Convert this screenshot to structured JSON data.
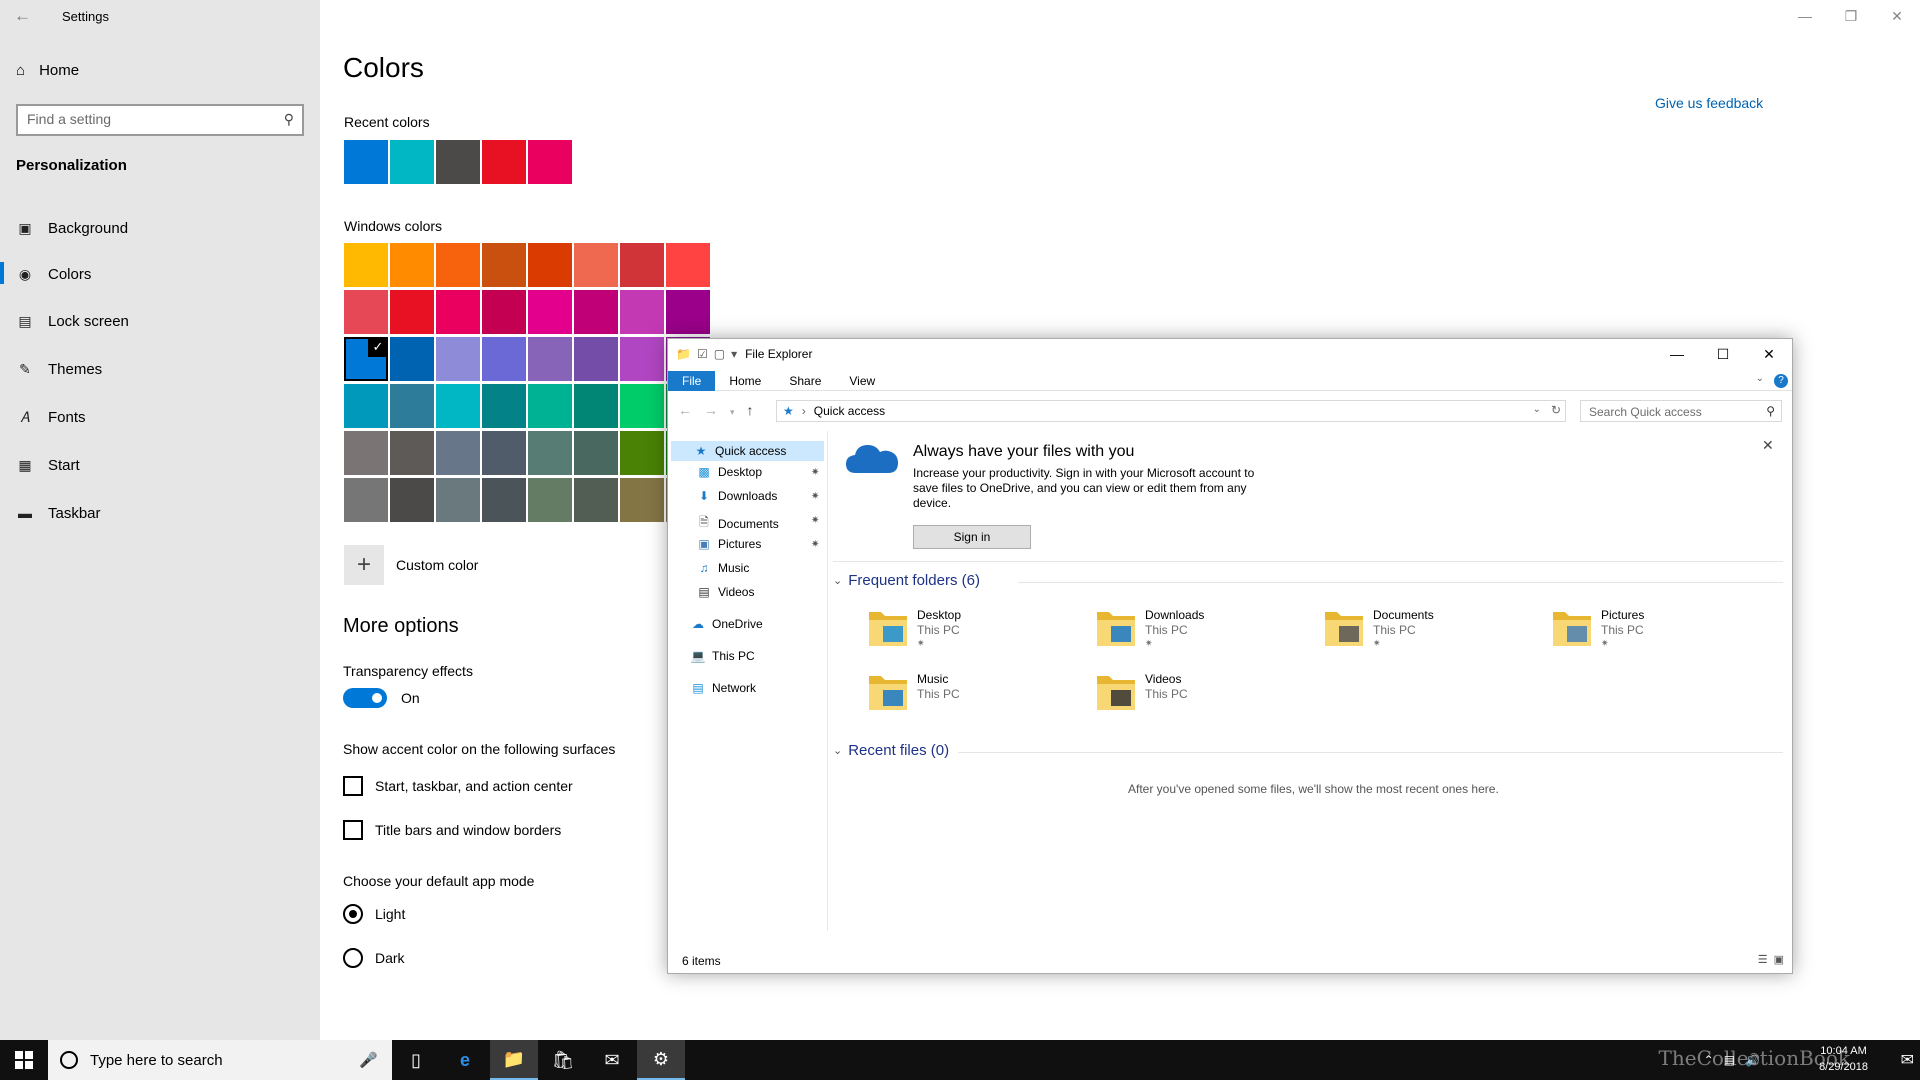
{
  "settings": {
    "title": "Settings",
    "home": "Home",
    "search_placeholder": "Find a setting",
    "section": "Personalization",
    "nav": [
      {
        "label": "Background",
        "icon": "picture-icon"
      },
      {
        "label": "Colors",
        "icon": "palette-icon"
      },
      {
        "label": "Lock screen",
        "icon": "monitor-icon"
      },
      {
        "label": "Themes",
        "icon": "brush-icon"
      },
      {
        "label": "Fonts",
        "icon": "font-icon"
      },
      {
        "label": "Start",
        "icon": "grid-icon"
      },
      {
        "label": "Taskbar",
        "icon": "taskbar-icon"
      }
    ],
    "active_nav": "Colors",
    "accent_color": "#0078d7"
  },
  "colors_page": {
    "title": "Colors",
    "feedback": "Give us feedback",
    "recent_label": "Recent colors",
    "recent_colors": [
      "#0078d7",
      "#00b7c3",
      "#4c4a48",
      "#e81123",
      "#ea005e"
    ],
    "windows_label": "Windows colors",
    "windows_colors": [
      [
        "#ffb900",
        "#ff8c00",
        "#f7630c",
        "#ca5010",
        "#da3b01",
        "#ef6950",
        "#d13438",
        "#ff4343"
      ],
      [
        "#e74856",
        "#e81123",
        "#ea005e",
        "#c30052",
        "#e3008c",
        "#bf0077",
        "#c239b3",
        "#9a0089"
      ],
      [
        "#0078d7",
        "#0063b1",
        "#8e8cd8",
        "#6b69d6",
        "#8764b8",
        "#744da9",
        "#b146c2",
        "#881798"
      ],
      [
        "#0099bc",
        "#2d7d9a",
        "#00b7c3",
        "#038387",
        "#00b294",
        "#018574",
        "#00cc6a",
        "#10893e"
      ],
      [
        "#7a7574",
        "#5d5a58",
        "#68768a",
        "#515c6b",
        "#567c73",
        "#486860",
        "#498205",
        "#107c10"
      ],
      [
        "#767676",
        "#4c4a48",
        "#69797e",
        "#4a5459",
        "#647c64",
        "#525e54",
        "#847545",
        "#7e735f"
      ]
    ],
    "selected_color": "#0078d7",
    "custom_color": "Custom color",
    "more_options": "More options",
    "transparency_label": "Transparency effects",
    "transparency_state": "On",
    "surfaces_label": "Show accent color on the following surfaces",
    "surface_options": [
      "Start, taskbar, and action center",
      "Title bars and window borders"
    ],
    "app_mode_label": "Choose your default app mode",
    "app_modes": [
      "Light",
      "Dark"
    ],
    "app_mode_selected": "Light"
  },
  "explorer": {
    "title": "File Explorer",
    "ribbon_tabs": [
      "File",
      "Home",
      "Share",
      "View"
    ],
    "address": "Quick access",
    "search_placeholder": "Search Quick access",
    "nav": {
      "quick_access": "Quick access",
      "pinned": [
        "Desktop",
        "Downloads",
        "Documents",
        "Pictures"
      ],
      "unpinned": [
        "Music",
        "Videos"
      ],
      "onedrive": "OneDrive",
      "this_pc": "This PC",
      "network": "Network"
    },
    "banner": {
      "title": "Always have your files with you",
      "text": "Increase your productivity. Sign in with your Microsoft account to save files to OneDrive, and you can view or edit them from any device.",
      "button": "Sign in"
    },
    "frequent_header": "Frequent folders (6)",
    "folders": [
      {
        "name": "Desktop",
        "location": "This PC",
        "pinned": true
      },
      {
        "name": "Downloads",
        "location": "This PC",
        "pinned": true
      },
      {
        "name": "Documents",
        "location": "This PC",
        "pinned": true
      },
      {
        "name": "Pictures",
        "location": "This PC",
        "pinned": true
      },
      {
        "name": "Music",
        "location": "This PC",
        "pinned": false
      },
      {
        "name": "Videos",
        "location": "This PC",
        "pinned": false
      }
    ],
    "recent_header": "Recent files (0)",
    "recent_empty": "After you've opened some files, we'll show the most recent ones here.",
    "status": "6 items"
  },
  "taskbar": {
    "search_placeholder": "Type here to search",
    "time": "10:04 AM",
    "date": "8/29/2018",
    "watermark": "TheCollectionBook"
  }
}
